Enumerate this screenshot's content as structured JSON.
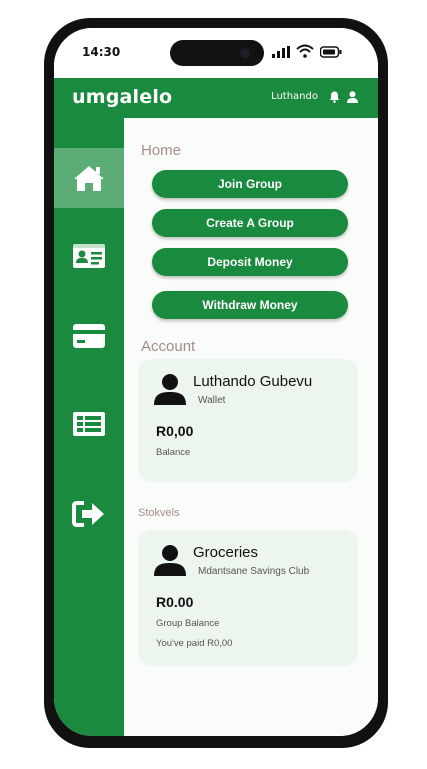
{
  "status": {
    "time": "14:30"
  },
  "appbar": {
    "logo": "umgalelo",
    "username": "Luthando"
  },
  "sidebar": {
    "items": [
      {
        "icon": "home-icon",
        "active": true
      },
      {
        "icon": "id-card-icon",
        "active": false
      },
      {
        "icon": "credit-card-icon",
        "active": false
      },
      {
        "icon": "list-icon",
        "active": false
      },
      {
        "icon": "logout-icon",
        "active": false
      }
    ]
  },
  "home": {
    "title": "Home",
    "buttons": [
      "Join Group",
      "Create A Group",
      "Deposit Money",
      "Withdraw Money"
    ]
  },
  "account": {
    "title": "Account",
    "name": "Luthando Gubevu",
    "sub": "Wallet",
    "amount": "R0,00",
    "amount_label": "Balance"
  },
  "stokvels": {
    "title": "Stokvels",
    "card": {
      "name": "Groceries",
      "sub": "Mdantsane Savings Club",
      "amount": "R0.00",
      "amount_label": "Group Balance",
      "paid": "You've paid R0,00"
    }
  },
  "colors": {
    "brand": "#1a8a3e",
    "active": "#5cac76",
    "card": "#edf6ee",
    "section_title": "#a58b8b"
  }
}
